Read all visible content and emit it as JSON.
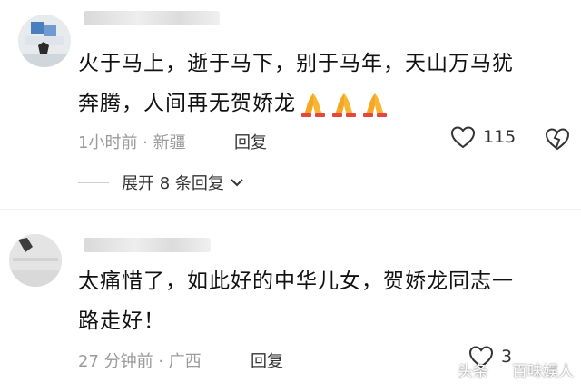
{
  "comments": [
    {
      "username": "",
      "text_line1": "火于马上，逝于马下，别于马年，天山万马犹",
      "text_line2": "奔腾，人间再无贺娇龙",
      "emoji_icon": "folded-hands-icon",
      "emoji_count": 3,
      "time_location": "1小时前 · 新疆",
      "reply_label": "回复",
      "likes": "115",
      "replies_label": "展开 8 条回复"
    },
    {
      "username": "",
      "text_line1": "太痛惜了，如此好的中华儿女，贺娇龙同志一",
      "text_line2": "路走好！",
      "time_location": "27 分钟前 · 广西",
      "reply_label": "回复",
      "likes": "3"
    }
  ],
  "watermark": {
    "prefix": "头条",
    "name": "百味娱人"
  },
  "colors": {
    "meta_gray": "#9a9a9a",
    "emoji_orange": "#f5a623"
  }
}
